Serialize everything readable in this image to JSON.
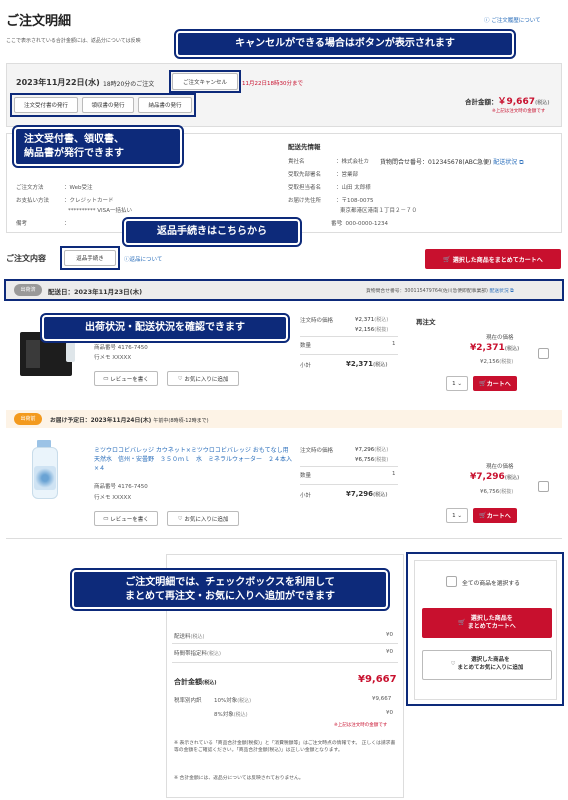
{
  "page": {
    "title": "ご注文明細",
    "history_link": "ご注文履歴について",
    "notice": "ここで表示されている合計金額には、返品分については反映"
  },
  "callouts": {
    "cancel": "キャンセルができる場合はボタンが表示されます",
    "issue": "注文受付書、領収書、\n納品書が発行できます",
    "returns": "返品手続きはこちらから",
    "shipping": "出荷状況・配送状況を確認できます",
    "checkbox": "ご注文明細では、チェックボックスを利用して\nまとめて再注文・お気に入りへ追加ができます"
  },
  "order": {
    "date": "2023年11月22日(水)",
    "time_label": "18時20分のご注文",
    "cancel_button": "ご注文キャンセル",
    "cancel_deadline": "11月22日18時30分まで",
    "total_label": "合計金額：",
    "total_value": "￥9,667",
    "tax": "(税込)",
    "total_note": "※上記は注文時の金額です",
    "doc_buttons": [
      "注文受付書の発行",
      "領収書の発行",
      "納品書の発行"
    ]
  },
  "info_left": [
    {
      "label": "ご注文方法",
      "value": "：Web受注"
    },
    {
      "label": "お支払い方法",
      "value": "：クレジットカード"
    },
    {
      "label": "",
      "value": "********** VISA一括払い"
    },
    {
      "label": "備考",
      "value": "："
    }
  ],
  "delivery": {
    "heading": "配送先情報",
    "rows": [
      {
        "label": "貴社名",
        "value": "：株式会社カ"
      },
      {
        "label": "受取先部署名",
        "value": "：営業部"
      },
      {
        "label": "受取担当者名",
        "value": "：山田 太郎様"
      },
      {
        "label": "お届け先住所",
        "value": "：〒108-0075"
      },
      {
        "label": "",
        "value": "東京都港区港南１丁目２－７０"
      },
      {
        "label": "番号",
        "value": "：000-0000-1234"
      }
    ],
    "tracking_label": "貨物問合せ番号：012345678(ABC急便)",
    "tracking_link": "配送状況"
  },
  "contents": {
    "heading": "ご注文内容",
    "return_button": "返品手続き",
    "return_link": "返品について",
    "bulk_cart_button": "選択した商品をまとめてカートへ"
  },
  "shipments": [
    {
      "status": "出荷済",
      "date": "配送日：2023年11月23日(木)",
      "tracking": "貨物問合せ番号：300115479764(佐川急便即配事業部)",
      "tracking_link": "配送状況",
      "product_name": "",
      "product_code": "商品番号 4176-7450",
      "memo": "行メモ XXXXX",
      "price_label": "注文時の価格",
      "price1": "¥2,371",
      "price1_tax": "(税込)",
      "price2": "¥2,156",
      "price2_tax": "(税抜)",
      "qty_label": "数量",
      "qty": "1",
      "subtotal_label": "小計",
      "subtotal": "¥2,371",
      "subtotal_tax": "(税込)",
      "reorder_label": "再注文",
      "current_label": "現在の価格",
      "current_price": "¥2,371",
      "current_tax": "(税込)",
      "current_sub": "¥2,156",
      "current_sub_tax": "(税抜)",
      "qty_select": "1",
      "cart_button": "カートへ",
      "review_button": "レビューを書く",
      "fav_button": "お気に入りに追加"
    },
    {
      "status": "出荷前",
      "date": "お届け予定日：2023年11月24日(木)",
      "time": "午前中(8時頃-12時まで)",
      "product_name": "ミツウロコビバレッジ カウネット×ミツウロコビバレッジ おもてなし用天然水　信州・安曇野　３５０ｍｌ　水　ミネラルウォーター　２４本入×４",
      "product_code": "商品番号 4176-7450",
      "memo": "行メモ XXXXX",
      "price_label": "注文時の価格",
      "price1": "¥7,296",
      "price1_tax": "(税込)",
      "price2": "¥6,756",
      "price2_tax": "(税抜)",
      "qty_label": "数量",
      "qty": "1",
      "subtotal_label": "小計",
      "subtotal": "¥7,296",
      "subtotal_tax": "(税込)",
      "current_label": "現在の価格",
      "current_price": "¥7,296",
      "current_tax": "(税込)",
      "current_sub": "¥6,756",
      "current_sub_tax": "(税抜)",
      "qty_select": "1",
      "cart_button": "カートへ",
      "review_button": "レビューを書く",
      "fav_button": "お気に入りに追加"
    }
  ],
  "summary": {
    "rows": [
      {
        "label": "配送料",
        "tax": "(税込)",
        "value": "¥0"
      },
      {
        "label": "時間帯指定料",
        "tax": "(税込)",
        "value": "¥0"
      }
    ],
    "total_label": "合計金額",
    "total_tax": "(税込)",
    "total_value": "¥9,667",
    "tax_breakdown_label": "税率別内訳",
    "tax10_label": "10%対象",
    "tax10_tax": "(税込)",
    "tax10_value": "¥9,667",
    "tax8_label": "8%対象",
    "tax8_tax": "(税込)",
    "tax8_value": "¥0",
    "note": "※上記は注文時の金額です",
    "footnote1": "※ 表示されている「商品合計金額(税抜)」と「消費税額等」はご注文時点の情報です。 正しくは請求書等の金額をご確認ください。「商品合計金額(税込)」は正しい金額となります。",
    "footnote2": "※ 合計金額には、返品分については反映されておりません。"
  },
  "sidebar": {
    "select_all": "全ての商品を選択する",
    "bulk_cart": "選択した商品を\nまとめてカートへ",
    "bulk_fav": "選択した商品を\nまとめてお気に入りに追加"
  },
  "colors": {
    "accent": "#c8102e",
    "callout": "#0d2a7a"
  }
}
